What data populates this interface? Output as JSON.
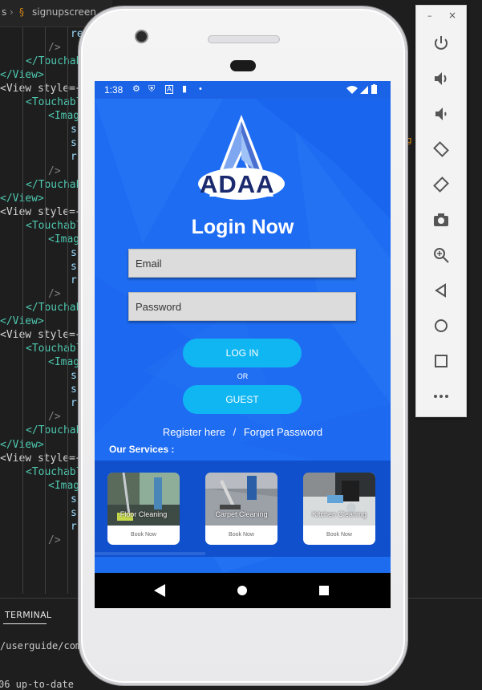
{
  "editor": {
    "breadcrumb_prefix": "s",
    "breadcrumb_file": "signupscreen",
    "lines": [
      {
        "indent": 88,
        "text": "re",
        "cls": "kw"
      },
      {
        "indent": 60,
        "text": "/>",
        "cls": "p"
      },
      {
        "indent": 32,
        "text": "</Touchab",
        "cls": "tag"
      },
      {
        "indent": 0,
        "text": "</View>",
        "cls": "tag"
      },
      {
        "indent": 0,
        "text": "<View style={",
        "cls": "mix"
      },
      {
        "indent": 32,
        "text": "<Touchabl",
        "cls": "tag"
      },
      {
        "indent": 60,
        "text": "<Imag",
        "cls": "tag"
      },
      {
        "indent": 88,
        "text": "s",
        "cls": "kw"
      },
      {
        "indent": 88,
        "text": "s",
        "cls": "kw"
      },
      {
        "indent": 88,
        "text": "r",
        "cls": "kw"
      },
      {
        "indent": 60,
        "text": "/>",
        "cls": "p"
      },
      {
        "indent": 32,
        "text": "</Touchab",
        "cls": "tag"
      },
      {
        "indent": 0,
        "text": "</View>",
        "cls": "tag"
      },
      {
        "indent": 0,
        "text": "<View style={",
        "cls": "mix"
      },
      {
        "indent": 32,
        "text": "<Touchabl",
        "cls": "tag"
      },
      {
        "indent": 60,
        "text": "<Imag",
        "cls": "tag"
      },
      {
        "indent": 88,
        "text": "s",
        "cls": "kw"
      },
      {
        "indent": 88,
        "text": "s",
        "cls": "kw"
      },
      {
        "indent": 88,
        "text": "r",
        "cls": "kw"
      },
      {
        "indent": 60,
        "text": "/>",
        "cls": "p"
      },
      {
        "indent": 32,
        "text": "</Touchab",
        "cls": "tag"
      },
      {
        "indent": 0,
        "text": "</View>",
        "cls": "tag"
      },
      {
        "indent": 0,
        "text": "<View style={",
        "cls": "mix"
      },
      {
        "indent": 32,
        "text": "<Touchabl",
        "cls": "tag"
      },
      {
        "indent": 60,
        "text": "<Imag",
        "cls": "tag"
      },
      {
        "indent": 88,
        "text": "s",
        "cls": "kw"
      },
      {
        "indent": 88,
        "text": "s",
        "cls": "kw"
      },
      {
        "indent": 88,
        "text": "r",
        "cls": "kw"
      },
      {
        "indent": 60,
        "text": "/>",
        "cls": "p"
      },
      {
        "indent": 32,
        "text": "</Touchab",
        "cls": "tag"
      },
      {
        "indent": 0,
        "text": "</View>",
        "cls": "tag"
      },
      {
        "indent": 0,
        "text": "<View style={",
        "cls": "mix"
      },
      {
        "indent": 32,
        "text": "<Touchabl",
        "cls": "tag"
      },
      {
        "indent": 60,
        "text": "<Imag",
        "cls": "tag"
      },
      {
        "indent": 88,
        "text": "s",
        "cls": "kw"
      },
      {
        "indent": 88,
        "text": "s",
        "cls": "kw"
      },
      {
        "indent": 88,
        "text": "r",
        "cls": "kw"
      },
      {
        "indent": 60,
        "text": "/>",
        "cls": "p"
      }
    ],
    "orange_marker": "g"
  },
  "terminal": {
    "tab_label": "TERMINAL",
    "line1": "/userguide/comm",
    "line2": "06 up-to-date"
  },
  "status_bar": {
    "time": "1:38",
    "icons": [
      "gear-icon",
      "shield-icon",
      "a-icon",
      "lock-icon",
      "dot-icon"
    ],
    "right_icons": [
      "wifi-icon",
      "signal-icon",
      "battery-icon"
    ]
  },
  "app": {
    "logo_text": "ADAA",
    "title": "Login Now",
    "email_placeholder": "Email",
    "password_placeholder": "Password",
    "login_label": "LOG IN",
    "or_label": "OR",
    "guest_label": "GUEST",
    "register_label": "Register here",
    "separator": "/",
    "forget_label": "Forget Password",
    "services_title": "Our Services :",
    "services": [
      {
        "name": "Floor Cleaning",
        "action": "Book Now"
      },
      {
        "name": "Carpet Cleaning",
        "action": "Book Now"
      },
      {
        "name": "Kitchen Cleaning",
        "action": "Book Now"
      }
    ],
    "colors": {
      "background": "#1e6cf2",
      "button": "#10b6f2",
      "logo_text": "#1b2a6e"
    }
  },
  "emulator_toolbar": {
    "minimize": "–",
    "close": "×",
    "tools": [
      "power-icon",
      "volume-up-icon",
      "volume-down-icon",
      "rotate-left-icon",
      "rotate-right-icon",
      "screenshot-icon",
      "zoom-icon",
      "back-icon",
      "home-icon",
      "overview-icon",
      "more-icon"
    ]
  }
}
